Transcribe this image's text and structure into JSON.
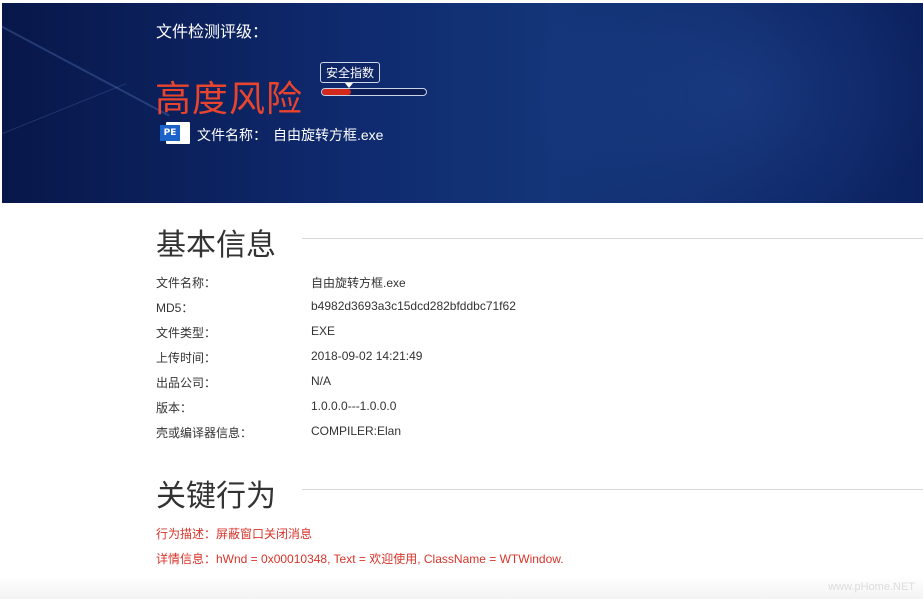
{
  "header": {
    "rating_label": "文件检测评级：",
    "risk_level": "高度风险",
    "safety_index_label": "安全指数",
    "safety_index_level": 0.28,
    "file_icon_text": "PE",
    "file_name_label": "文件名称：",
    "file_name_value": "自由旋转方框.exe",
    "risk_color": "#e8442e"
  },
  "basic_info": {
    "title": "基本信息",
    "rows": [
      {
        "key": "文件名称：",
        "value": "自由旋转方框.exe"
      },
      {
        "key": "MD5：",
        "value": "b4982d3693a3c15dcd282bfddbc71f62"
      },
      {
        "key": "文件类型：",
        "value": "EXE"
      },
      {
        "key": "上传时间：",
        "value": "2018-09-02 14:21:49"
      },
      {
        "key": "出品公司：",
        "value": "N/A"
      },
      {
        "key": "版本：",
        "value": "1.0.0.0---1.0.0.0"
      },
      {
        "key": "壳或编译器信息：",
        "value": "COMPILER:Elan"
      }
    ]
  },
  "key_behavior": {
    "title": "关键行为",
    "description": "行为描述：屏蔽窗口关闭消息",
    "detail": "详情信息：hWnd = 0x00010348, Text = 欢迎使用, ClassName = WTWindow."
  },
  "watermark": "www.pHome.NET"
}
